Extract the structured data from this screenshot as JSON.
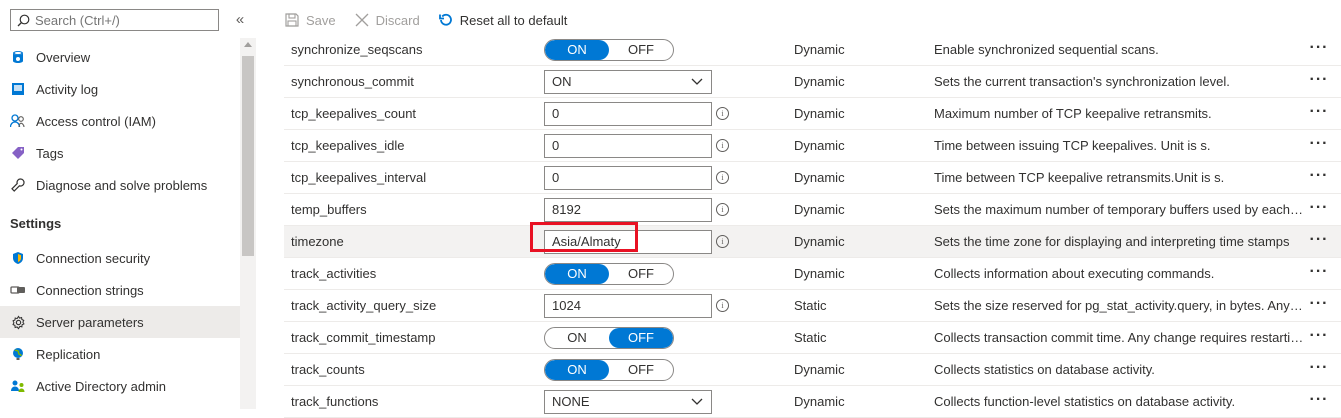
{
  "search": {
    "placeholder": "Search (Ctrl+/)"
  },
  "sidebar": {
    "collapse_glyph": "«",
    "items": [
      {
        "label": "Overview",
        "icon": "overview-icon"
      },
      {
        "label": "Activity log",
        "icon": "activity-log-icon"
      },
      {
        "label": "Access control (IAM)",
        "icon": "people-icon"
      },
      {
        "label": "Tags",
        "icon": "tag-icon"
      },
      {
        "label": "Diagnose and solve problems",
        "icon": "wrench-icon"
      }
    ],
    "settings_heading": "Settings",
    "settings_items": [
      {
        "label": "Connection security",
        "icon": "shield-icon"
      },
      {
        "label": "Connection strings",
        "icon": "connection-strings-icon"
      },
      {
        "label": "Server parameters",
        "icon": "gear-icon",
        "active": true
      },
      {
        "label": "Replication",
        "icon": "globe-icon"
      },
      {
        "label": "Active Directory admin",
        "icon": "ad-admin-icon"
      }
    ]
  },
  "toolbar": {
    "save": "Save",
    "discard": "Discard",
    "reset": "Reset all to default"
  },
  "toggle_labels": {
    "on": "ON",
    "off": "OFF"
  },
  "info_glyph": "i",
  "more_glyph": "···",
  "params": [
    {
      "name": "synchronize_seqscans",
      "control": "toggle",
      "value": "ON",
      "type": "Dynamic",
      "description": "Enable synchronized sequential scans."
    },
    {
      "name": "synchronous_commit",
      "control": "select",
      "value": "ON",
      "type": "Dynamic",
      "description": "Sets the current transaction's synchronization level."
    },
    {
      "name": "tcp_keepalives_count",
      "control": "text",
      "value": "0",
      "type": "Dynamic",
      "description": "Maximum number of TCP keepalive retransmits."
    },
    {
      "name": "tcp_keepalives_idle",
      "control": "text",
      "value": "0",
      "type": "Dynamic",
      "description": "Time between issuing TCP keepalives. Unit is s."
    },
    {
      "name": "tcp_keepalives_interval",
      "control": "text",
      "value": "0",
      "type": "Dynamic",
      "description": "Time between TCP keepalive retransmits.Unit is s."
    },
    {
      "name": "temp_buffers",
      "control": "text",
      "value": "8192",
      "type": "Dynamic",
      "description": "Sets the maximum number of temporary buffers used by each ..."
    },
    {
      "name": "timezone",
      "control": "text",
      "value": "Asia/Almaty",
      "type": "Dynamic",
      "description": "Sets the time zone for displaying and interpreting time stamps",
      "highlighted": true
    },
    {
      "name": "track_activities",
      "control": "toggle",
      "value": "ON",
      "type": "Dynamic",
      "description": "Collects information about executing commands."
    },
    {
      "name": "track_activity_query_size",
      "control": "text",
      "value": "1024",
      "type": "Static",
      "description": "Sets the size reserved for pg_stat_activity.query, in bytes. Any c..."
    },
    {
      "name": "track_commit_timestamp",
      "control": "toggle",
      "value": "OFF",
      "type": "Static",
      "description": "Collects transaction commit time. Any change requires restartin..."
    },
    {
      "name": "track_counts",
      "control": "toggle",
      "value": "ON",
      "type": "Dynamic",
      "description": "Collects statistics on database activity."
    },
    {
      "name": "track_functions",
      "control": "select",
      "value": "NONE",
      "type": "Dynamic",
      "description": "Collects function-level statistics on database activity."
    }
  ],
  "colors": {
    "accent": "#0078d4",
    "highlight_border": "#e81123",
    "row_highlight": "#f3f2f1"
  }
}
